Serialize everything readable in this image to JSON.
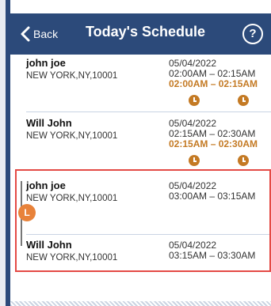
{
  "header": {
    "back_label": "Back",
    "title": "Today's Schedule",
    "help_label": "?"
  },
  "entries": [
    {
      "name": "john joe",
      "address": "NEW YORK,NY,10001",
      "date": "05/04/2022",
      "time": "02:00AM  – 02:15AM",
      "time2": "02:00AM  – 02:15AM",
      "has_clock_icons": true
    },
    {
      "name": "Will John",
      "address": "NEW YORK,NY,10001",
      "date": "05/04/2022",
      "time": "02:15AM  – 02:30AM",
      "time2": "02:15AM  – 02:30AM",
      "has_clock_icons": true
    },
    {
      "name": "john joe",
      "address": "NEW YORK,NY,10001",
      "date": "05/04/2022",
      "time": "03:00AM  – 03:15AM",
      "time2": "",
      "has_clock_icons": false
    },
    {
      "name": "Will John",
      "address": "NEW YORK,NY,10001",
      "date": "05/04/2022",
      "time": "03:15AM  – 03:30AM",
      "time2": "",
      "has_clock_icons": false
    }
  ],
  "selection": {
    "badge_label": "L"
  },
  "colors": {
    "header": "#2c4a7a",
    "accent_time": "#c47a24",
    "selection": "#e44a45",
    "handle_badge": "#e8823a"
  }
}
